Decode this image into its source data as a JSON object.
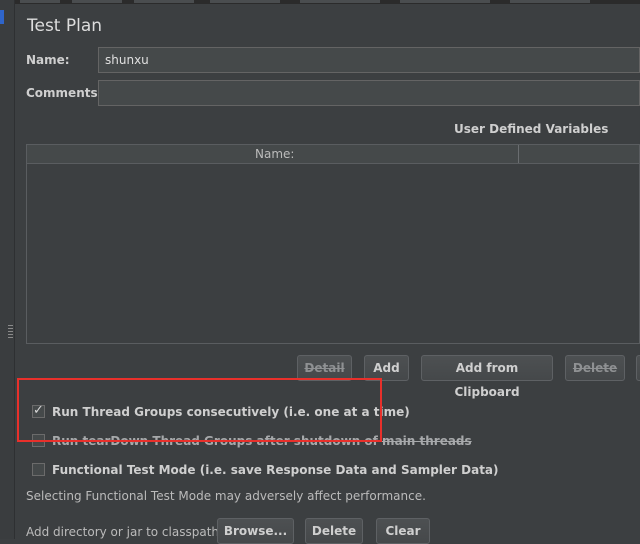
{
  "test_plan": {
    "title": "Test Plan",
    "name_label": "Name:",
    "name_value": "shunxu",
    "comments_label": "Comments:",
    "comments_value": ""
  },
  "user_defined_variables": {
    "section_title": "User Defined Variables",
    "columns": [
      "Name:",
      ""
    ],
    "rows": []
  },
  "table_buttons": {
    "detail": "Detail",
    "add": "Add",
    "add_from_clipboard": "Add from Clipboard",
    "delete": "Delete"
  },
  "options": {
    "run_consecutively": {
      "label": "Run Thread Groups consecutively (i.e. one at a time)",
      "checked": true
    },
    "teardown_after_shutdown": {
      "label": "Run tearDown Thread Groups after shutdown of main threads",
      "checked": false
    },
    "functional_mode": {
      "label": "Functional Test Mode (i.e. save Response Data and Sampler Data)",
      "checked": false
    }
  },
  "functional_warning": "Selecting Functional Test Mode may adversely affect performance.",
  "classpath": {
    "label": "Add directory or jar to classpath",
    "browse": "Browse...",
    "delete": "Delete",
    "clear": "Clear"
  },
  "colors": {
    "background": "#3c3f41",
    "highlight_box": "#e8302b"
  }
}
